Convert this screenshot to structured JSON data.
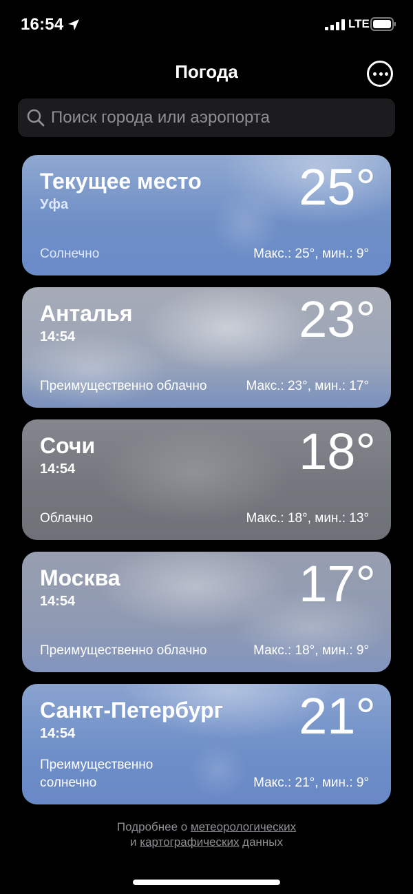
{
  "status_bar": {
    "time": "16:54",
    "network": "LTE",
    "icons": [
      "location-arrow-icon",
      "signal-icon",
      "battery-icon"
    ]
  },
  "header": {
    "title": "Погода",
    "more_icon": "ellipsis-circle-icon"
  },
  "search": {
    "placeholder": "Поиск города или аэропорта",
    "icon": "search-icon"
  },
  "cities": [
    {
      "name": "Текущее место",
      "subtitle": "Уфа",
      "temp": "25°",
      "condition": "Солнечно",
      "range": "Макс.: 25°, мин.: 9°"
    },
    {
      "name": "Анталья",
      "subtitle": "14:54",
      "temp": "23°",
      "condition": "Преимущественно облачно",
      "range": "Макс.: 23°, мин.: 17°"
    },
    {
      "name": "Сочи",
      "subtitle": "14:54",
      "temp": "18°",
      "condition": "Облачно",
      "range": "Макс.: 18°, мин.: 13°"
    },
    {
      "name": "Москва",
      "subtitle": "14:54",
      "temp": "17°",
      "condition": "Преимущественно облачно",
      "range": "Макс.: 18°, мин.: 9°"
    },
    {
      "name": "Санкт-Петербург",
      "subtitle": "14:54",
      "temp": "21°",
      "condition": "Преимущественно солнечно",
      "range": "Макс.: 21°, мин.: 9°"
    }
  ],
  "footer": {
    "prefix": "Подробнее о ",
    "link1": "метеорологических",
    "middle": "и ",
    "link2": "картографических",
    "suffix": " данных"
  }
}
